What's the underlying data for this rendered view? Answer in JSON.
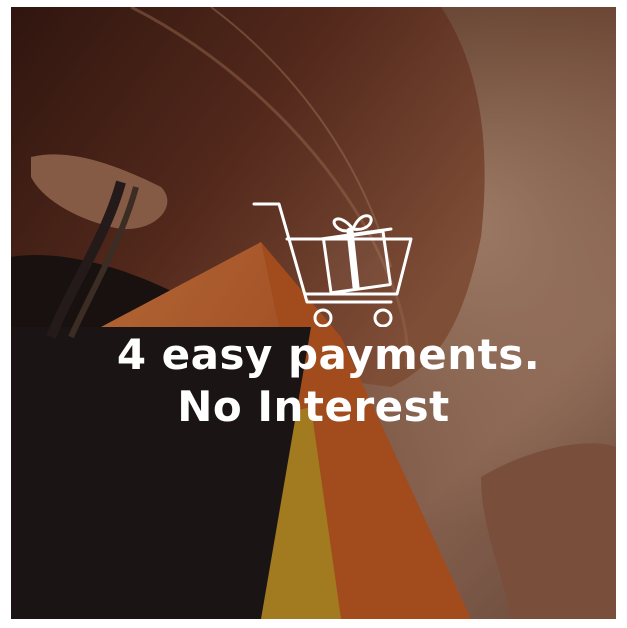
{
  "promo": {
    "headline_line1": "4 easy payments.",
    "headline_line2": "No Interest"
  },
  "icons": {
    "cart": "shopping-cart-with-gift-icon"
  },
  "colors": {
    "text": "#ffffff",
    "bag_orange": "#e06a2c",
    "bag_black": "#1c1a1a",
    "bag_yellow": "#d8a52a"
  }
}
